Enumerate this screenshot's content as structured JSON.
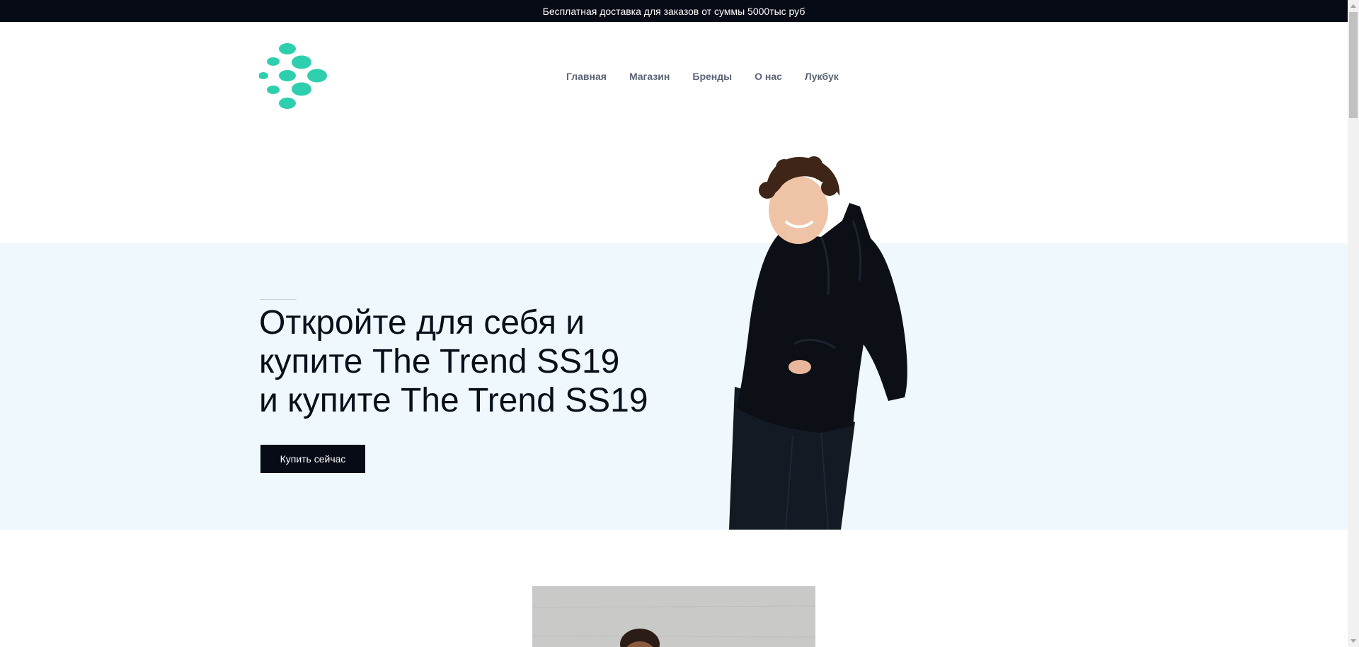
{
  "promo": {
    "text": "Бесплатная доставка для заказов от суммы 5000тыс руб"
  },
  "header": {
    "logo_icon": "dots-logo-icon",
    "brand_color": "#2ecfaf",
    "nav": [
      {
        "label": "Главная"
      },
      {
        "label": "Магазин"
      },
      {
        "label": "Бренды"
      },
      {
        "label": "О нас"
      },
      {
        "label": "Лукбук"
      }
    ]
  },
  "hero": {
    "title_lines": [
      "Откройте для себя и",
      "купите The Trend SS19",
      "и купите The Trend SS19"
    ],
    "cta_label": "Купить сейчас",
    "background_color": "#eff8fd",
    "image": "smiling-man-in-black-hoodie"
  },
  "featured": {
    "image": "man-on-concrete-wall"
  }
}
